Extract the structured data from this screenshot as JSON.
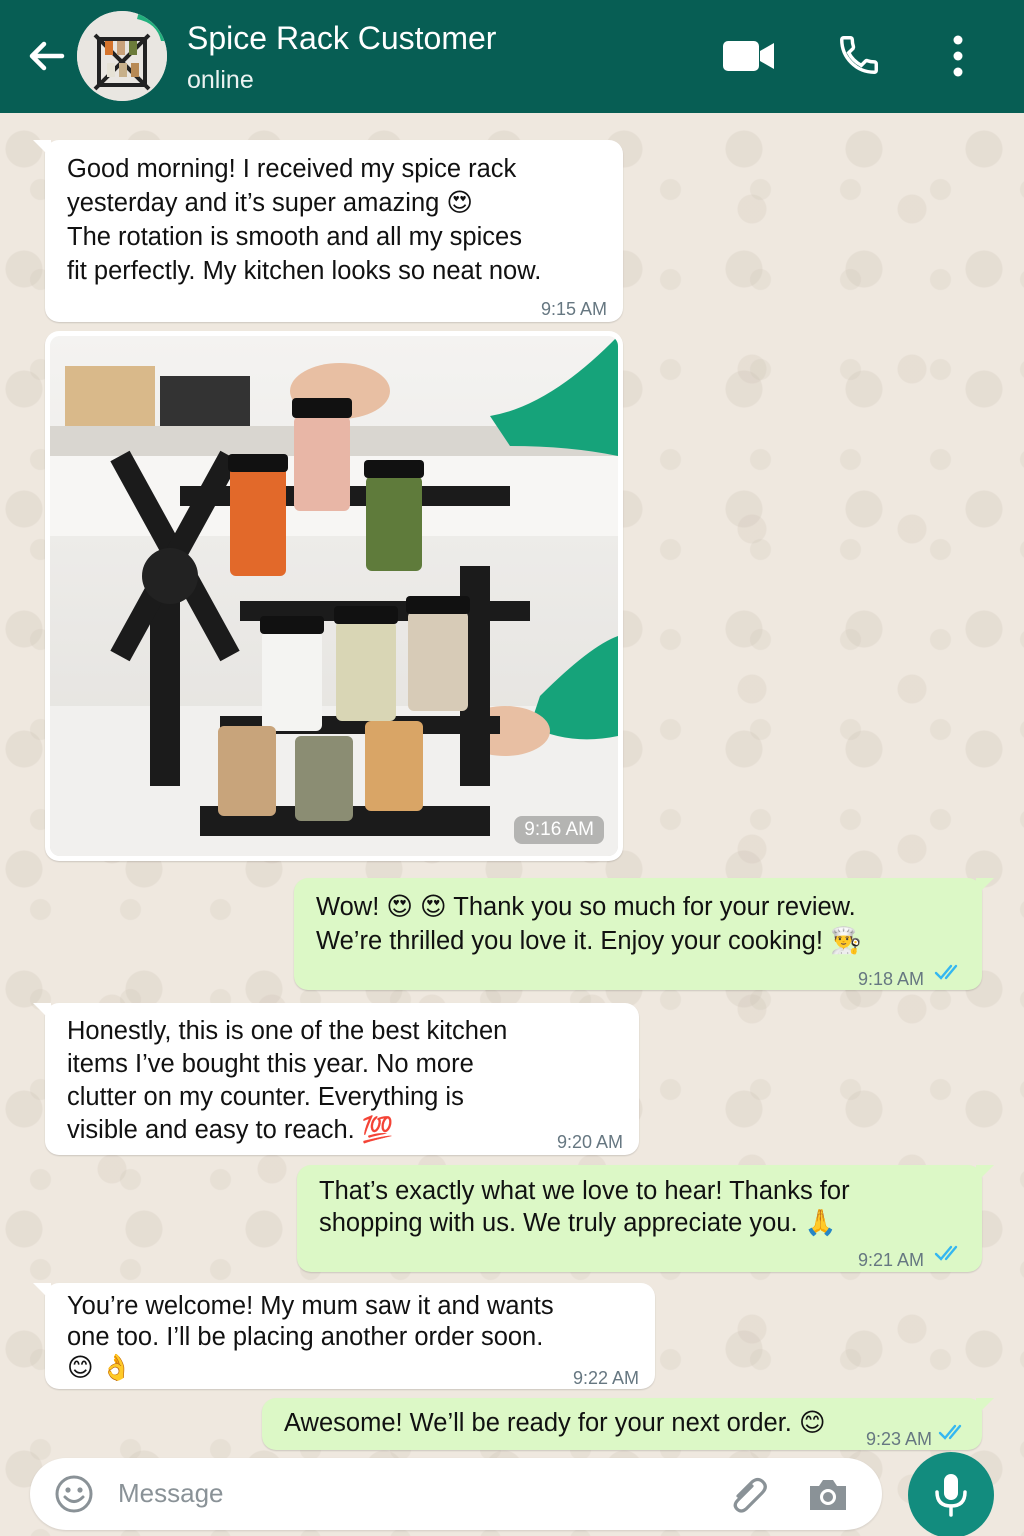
{
  "header": {
    "contact_name": "Spice Rack Customer",
    "status": "online"
  },
  "colors": {
    "header_bg": "#075e54",
    "incoming_bubble": "#ffffff",
    "outgoing_bubble": "#dcf8c6",
    "read_ticks": "#34b7f1",
    "mic_button": "#128c7e"
  },
  "messages": [
    {
      "direction": "in",
      "lines": [
        "Good morning! I received my spice rack",
        "yesterday and it’s super amazing 😍",
        "The rotation is smooth and all my spices",
        "fit perfectly. My kitchen looks so neat now."
      ],
      "time": "9:15 AM"
    },
    {
      "direction": "in",
      "type": "image",
      "image_description": "rotating black spice rack with glass jars",
      "time": "9:16 AM"
    },
    {
      "direction": "out",
      "lines": [
        "Wow! 😍 😍 Thank you so much for your review.",
        "We’re thrilled you love it. Enjoy your cooking! 👨‍🍳"
      ],
      "time": "9:18 AM",
      "status": "read"
    },
    {
      "direction": "in",
      "lines": [
        "Honestly, this is one of the best kitchen",
        "items I’ve bought this year. No more",
        "clutter on my counter. Everything is",
        "visible and easy to reach. 💯"
      ],
      "time": "9:20 AM"
    },
    {
      "direction": "out",
      "lines": [
        "That’s exactly what we love to hear! Thanks for",
        "shopping with us. We truly appreciate you. 🙏"
      ],
      "time": "9:21 AM",
      "status": "read"
    },
    {
      "direction": "in",
      "lines": [
        "You’re welcome! My mum saw it and wants",
        "one too. I’ll be placing another order soon.",
        "😊 👌"
      ],
      "time": "9:22 AM"
    },
    {
      "direction": "out",
      "lines": [
        "Awesome! We’ll be ready for your next order. 😊"
      ],
      "time": "9:23 AM",
      "status": "read"
    }
  ],
  "input": {
    "placeholder": "Message"
  },
  "icons": [
    "back-arrow-icon",
    "video-call-icon",
    "phone-icon",
    "more-options-icon",
    "emoji-icon",
    "attach-icon",
    "camera-icon",
    "mic-icon",
    "double-check-icon"
  ]
}
